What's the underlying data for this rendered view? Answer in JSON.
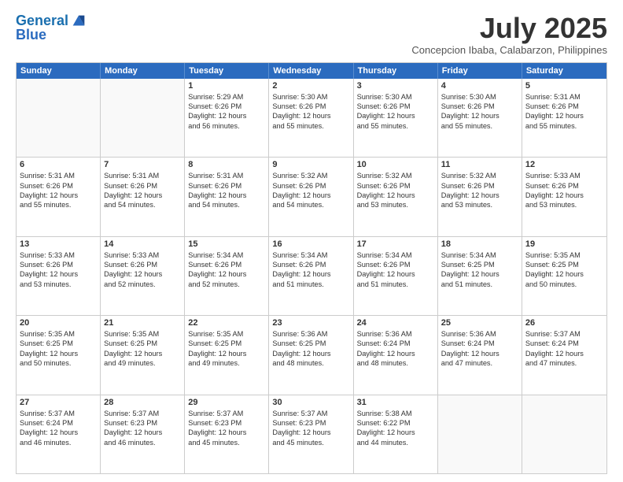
{
  "header": {
    "logo_line1": "General",
    "logo_line2": "Blue",
    "month": "July 2025",
    "location": "Concepcion Ibaba, Calabarzon, Philippines"
  },
  "days_of_week": [
    "Sunday",
    "Monday",
    "Tuesday",
    "Wednesday",
    "Thursday",
    "Friday",
    "Saturday"
  ],
  "weeks": [
    [
      {
        "day": "",
        "empty": true
      },
      {
        "day": "",
        "empty": true
      },
      {
        "day": "1",
        "lines": [
          "Sunrise: 5:29 AM",
          "Sunset: 6:26 PM",
          "Daylight: 12 hours",
          "and 56 minutes."
        ]
      },
      {
        "day": "2",
        "lines": [
          "Sunrise: 5:30 AM",
          "Sunset: 6:26 PM",
          "Daylight: 12 hours",
          "and 55 minutes."
        ]
      },
      {
        "day": "3",
        "lines": [
          "Sunrise: 5:30 AM",
          "Sunset: 6:26 PM",
          "Daylight: 12 hours",
          "and 55 minutes."
        ]
      },
      {
        "day": "4",
        "lines": [
          "Sunrise: 5:30 AM",
          "Sunset: 6:26 PM",
          "Daylight: 12 hours",
          "and 55 minutes."
        ]
      },
      {
        "day": "5",
        "lines": [
          "Sunrise: 5:31 AM",
          "Sunset: 6:26 PM",
          "Daylight: 12 hours",
          "and 55 minutes."
        ]
      }
    ],
    [
      {
        "day": "6",
        "lines": [
          "Sunrise: 5:31 AM",
          "Sunset: 6:26 PM",
          "Daylight: 12 hours",
          "and 55 minutes."
        ]
      },
      {
        "day": "7",
        "lines": [
          "Sunrise: 5:31 AM",
          "Sunset: 6:26 PM",
          "Daylight: 12 hours",
          "and 54 minutes."
        ]
      },
      {
        "day": "8",
        "lines": [
          "Sunrise: 5:31 AM",
          "Sunset: 6:26 PM",
          "Daylight: 12 hours",
          "and 54 minutes."
        ]
      },
      {
        "day": "9",
        "lines": [
          "Sunrise: 5:32 AM",
          "Sunset: 6:26 PM",
          "Daylight: 12 hours",
          "and 54 minutes."
        ]
      },
      {
        "day": "10",
        "lines": [
          "Sunrise: 5:32 AM",
          "Sunset: 6:26 PM",
          "Daylight: 12 hours",
          "and 53 minutes."
        ]
      },
      {
        "day": "11",
        "lines": [
          "Sunrise: 5:32 AM",
          "Sunset: 6:26 PM",
          "Daylight: 12 hours",
          "and 53 minutes."
        ]
      },
      {
        "day": "12",
        "lines": [
          "Sunrise: 5:33 AM",
          "Sunset: 6:26 PM",
          "Daylight: 12 hours",
          "and 53 minutes."
        ]
      }
    ],
    [
      {
        "day": "13",
        "lines": [
          "Sunrise: 5:33 AM",
          "Sunset: 6:26 PM",
          "Daylight: 12 hours",
          "and 53 minutes."
        ]
      },
      {
        "day": "14",
        "lines": [
          "Sunrise: 5:33 AM",
          "Sunset: 6:26 PM",
          "Daylight: 12 hours",
          "and 52 minutes."
        ]
      },
      {
        "day": "15",
        "lines": [
          "Sunrise: 5:34 AM",
          "Sunset: 6:26 PM",
          "Daylight: 12 hours",
          "and 52 minutes."
        ]
      },
      {
        "day": "16",
        "lines": [
          "Sunrise: 5:34 AM",
          "Sunset: 6:26 PM",
          "Daylight: 12 hours",
          "and 51 minutes."
        ]
      },
      {
        "day": "17",
        "lines": [
          "Sunrise: 5:34 AM",
          "Sunset: 6:26 PM",
          "Daylight: 12 hours",
          "and 51 minutes."
        ]
      },
      {
        "day": "18",
        "lines": [
          "Sunrise: 5:34 AM",
          "Sunset: 6:25 PM",
          "Daylight: 12 hours",
          "and 51 minutes."
        ]
      },
      {
        "day": "19",
        "lines": [
          "Sunrise: 5:35 AM",
          "Sunset: 6:25 PM",
          "Daylight: 12 hours",
          "and 50 minutes."
        ]
      }
    ],
    [
      {
        "day": "20",
        "lines": [
          "Sunrise: 5:35 AM",
          "Sunset: 6:25 PM",
          "Daylight: 12 hours",
          "and 50 minutes."
        ]
      },
      {
        "day": "21",
        "lines": [
          "Sunrise: 5:35 AM",
          "Sunset: 6:25 PM",
          "Daylight: 12 hours",
          "and 49 minutes."
        ]
      },
      {
        "day": "22",
        "lines": [
          "Sunrise: 5:35 AM",
          "Sunset: 6:25 PM",
          "Daylight: 12 hours",
          "and 49 minutes."
        ]
      },
      {
        "day": "23",
        "lines": [
          "Sunrise: 5:36 AM",
          "Sunset: 6:25 PM",
          "Daylight: 12 hours",
          "and 48 minutes."
        ]
      },
      {
        "day": "24",
        "lines": [
          "Sunrise: 5:36 AM",
          "Sunset: 6:24 PM",
          "Daylight: 12 hours",
          "and 48 minutes."
        ]
      },
      {
        "day": "25",
        "lines": [
          "Sunrise: 5:36 AM",
          "Sunset: 6:24 PM",
          "Daylight: 12 hours",
          "and 47 minutes."
        ]
      },
      {
        "day": "26",
        "lines": [
          "Sunrise: 5:37 AM",
          "Sunset: 6:24 PM",
          "Daylight: 12 hours",
          "and 47 minutes."
        ]
      }
    ],
    [
      {
        "day": "27",
        "lines": [
          "Sunrise: 5:37 AM",
          "Sunset: 6:24 PM",
          "Daylight: 12 hours",
          "and 46 minutes."
        ]
      },
      {
        "day": "28",
        "lines": [
          "Sunrise: 5:37 AM",
          "Sunset: 6:23 PM",
          "Daylight: 12 hours",
          "and 46 minutes."
        ]
      },
      {
        "day": "29",
        "lines": [
          "Sunrise: 5:37 AM",
          "Sunset: 6:23 PM",
          "Daylight: 12 hours",
          "and 45 minutes."
        ]
      },
      {
        "day": "30",
        "lines": [
          "Sunrise: 5:37 AM",
          "Sunset: 6:23 PM",
          "Daylight: 12 hours",
          "and 45 minutes."
        ]
      },
      {
        "day": "31",
        "lines": [
          "Sunrise: 5:38 AM",
          "Sunset: 6:22 PM",
          "Daylight: 12 hours",
          "and 44 minutes."
        ]
      },
      {
        "day": "",
        "empty": true
      },
      {
        "day": "",
        "empty": true
      }
    ]
  ]
}
